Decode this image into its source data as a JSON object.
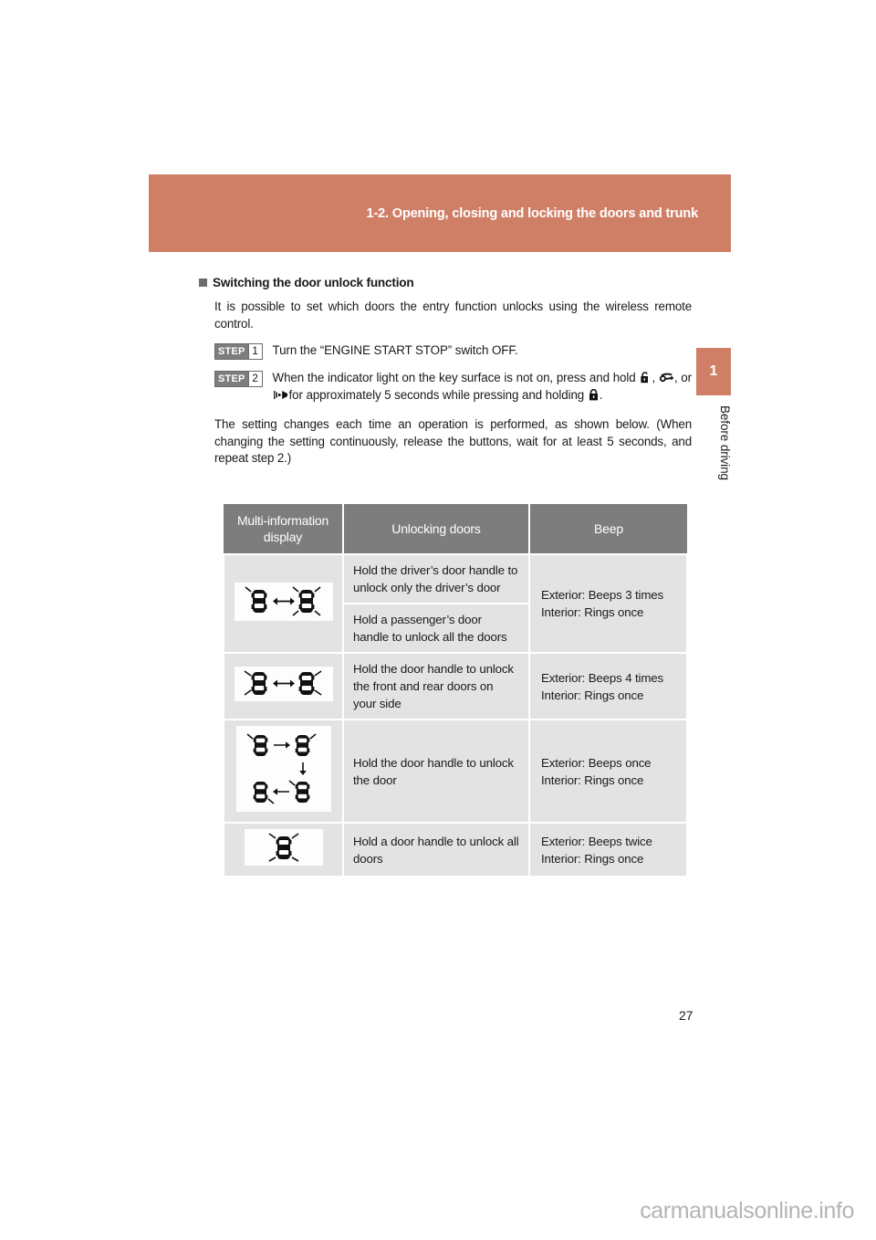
{
  "header": {
    "title": "1-2. Opening, closing and locking the doors and trunk",
    "band_color": "#d07f67"
  },
  "chapter_tab": {
    "number": "1",
    "label": "Before driving",
    "color": "#d07f67"
  },
  "section": {
    "heading": "Switching the door unlock function",
    "intro": "It is possible to set which doors the entry function unlocks using the wireless remote control.",
    "steps": [
      {
        "word": "STEP",
        "number": "1",
        "text": "Turn the “ENGINE START STOP” switch OFF."
      },
      {
        "word": "STEP",
        "number": "2",
        "text_part1": "When the indicator light on the key surface is not on, press and hold",
        "sep1": ",",
        "sep2": ", or",
        "text_part2": "for approximately 5 seconds while pressing and",
        "text_part3": "holding",
        "text_part4": "."
      }
    ],
    "note": "The setting changes each time an operation is performed, as shown below. (When changing the setting continuously, release the buttons, wait for at least 5 seconds, and repeat step 2.)"
  },
  "table": {
    "headers": [
      "Multi-information display",
      "Unlocking doors",
      "Beep"
    ],
    "header_line1": "Multi-information",
    "header_line2": "display",
    "rows": [
      {
        "icon": "two-cars-double-arrow-one-flashing",
        "unlocking": [
          "Hold the driver’s door handle to unlock only the driver’s door",
          "Hold a passenger’s door handle to unlock all the doors"
        ],
        "beep_exterior": "Exterior: Beeps 3 times",
        "beep_interior": "Interior: Rings once"
      },
      {
        "icon": "two-cars-double-arrow-side-flashing",
        "unlocking": [
          "Hold the door handle to unlock the front and rear doors on your side"
        ],
        "beep_exterior": "Exterior: Beeps 4 times",
        "beep_interior": "Interior: Rings once"
      },
      {
        "icon": "four-cars-cycle-arrows",
        "unlocking": [
          "Hold the door handle to unlock the door"
        ],
        "beep_exterior": "Exterior: Beeps once",
        "beep_interior": "Interior: Rings once"
      },
      {
        "icon": "single-car-all-flashing",
        "unlocking": [
          "Hold a door handle to unlock all doors"
        ],
        "beep_exterior": "Exterior: Beeps twice",
        "beep_interior": "Interior: Rings once"
      }
    ]
  },
  "page_number": "27",
  "watermark": "carmanualsonline.info"
}
